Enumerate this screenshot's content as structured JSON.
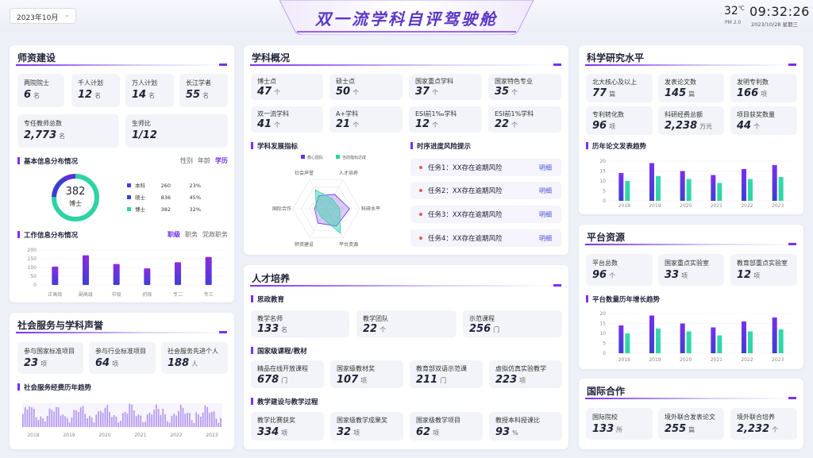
{
  "header": {
    "date_select": "2023年10月",
    "title": "双一流学科自评驾驶舱",
    "temperature": "32",
    "temp_unit": "℃",
    "pm": "PM 2.0",
    "time": "09:32:26",
    "date": "2023/10/28 星期三"
  },
  "colors": {
    "accent": "#7b2ff0",
    "purple": "#5b2fd8",
    "green": "#2ed3a3",
    "indigo": "#3a3fd0"
  },
  "faculty": {
    "title": "师资建设",
    "cards": [
      {
        "label": "两院院士",
        "value": "6",
        "unit": "名"
      },
      {
        "label": "千人计划",
        "value": "12",
        "unit": "名"
      },
      {
        "label": "万人计划",
        "value": "14",
        "unit": "名"
      },
      {
        "label": "长江学者",
        "value": "55",
        "unit": "名"
      },
      {
        "label": "专任教师总数",
        "value": "2,773",
        "unit": "名"
      },
      {
        "label": "生师比",
        "value": "1/12",
        "unit": ""
      }
    ],
    "basic": {
      "title": "基本信息分布情况",
      "tabs": [
        "性别",
        "年龄",
        "学历"
      ],
      "donut_value": "382",
      "donut_label": "博士",
      "legend": [
        {
          "name": "本科",
          "count": "260",
          "pct": "23%",
          "color": "#5b2fd8"
        },
        {
          "name": "硕士",
          "count": "836",
          "pct": "45%",
          "color": "#3a3fd0"
        },
        {
          "name": "博士",
          "count": "382",
          "pct": "32%",
          "color": "#2ed3a3"
        }
      ]
    },
    "work": {
      "title": "工作信息分布情况",
      "tabs": [
        "职级",
        "职务",
        "党政职务"
      ]
    }
  },
  "chart_data": [
    {
      "type": "bar",
      "categories": [
        "正高级",
        "副高级",
        "中级",
        "初级",
        "专二",
        "专三"
      ],
      "values": [
        105,
        170,
        120,
        95,
        130,
        160
      ],
      "ylim": [
        0,
        200
      ],
      "yticks": [
        "200",
        "150",
        "100",
        "50",
        "0"
      ]
    },
    {
      "type": "bar",
      "categories": [
        "2018",
        "2019",
        "2020",
        "2021",
        "2022",
        "2023"
      ],
      "series": [
        {
          "values": [
            14,
            19,
            15,
            13,
            16,
            18
          ]
        },
        {
          "values": [
            10,
            12.5,
            11,
            9,
            11,
            12
          ]
        }
      ],
      "ylim": [
        0,
        20
      ],
      "yticks": [
        "20",
        "15",
        "10",
        "5",
        "0"
      ]
    },
    {
      "type": "bar",
      "categories": [
        "2018",
        "2019",
        "2020",
        "2021",
        "2022",
        "2023"
      ],
      "series": [
        {
          "values": [
            14,
            19,
            15,
            13,
            16,
            18
          ]
        },
        {
          "values": [
            10,
            12.5,
            11,
            9,
            11,
            12
          ]
        }
      ],
      "ylim": [
        0,
        20
      ],
      "yticks": [
        "20",
        "15",
        "10",
        "5",
        "0"
      ]
    },
    {
      "type": "area",
      "x": [
        "2018",
        "2019",
        "2020",
        "2021",
        "2022",
        "2023"
      ]
    },
    {
      "type": "radar",
      "axes": [
        "人才培养",
        "科研水平",
        "平台资源",
        "师资建设",
        "国际合作",
        "社会声誉"
      ],
      "series": [
        {
          "name": "核心团队",
          "values": [
            0.5,
            0.7,
            0.6,
            0.5,
            0.35,
            0.45
          ]
        },
        {
          "name": "当前指标达成",
          "values": [
            0.35,
            0.4,
            0.85,
            0.3,
            0.3,
            0.65
          ]
        }
      ]
    }
  ],
  "social": {
    "title": "社会服务与学科声誉",
    "cards": [
      {
        "label": "参与国家标准项目",
        "value": "23",
        "unit": "项"
      },
      {
        "label": "参与行业标准项目",
        "value": "64",
        "unit": "项"
      },
      {
        "label": "社会服务先进个人",
        "value": "188",
        "unit": "人"
      }
    ],
    "trend_title": "社会服务经费历年趋势"
  },
  "discipline": {
    "title": "学科概况",
    "cards": [
      {
        "label": "博士点",
        "value": "47",
        "unit": "个"
      },
      {
        "label": "硕士点",
        "value": "50",
        "unit": "个"
      },
      {
        "label": "国家重点学科",
        "value": "37",
        "unit": "个"
      },
      {
        "label": "国家特色专业",
        "value": "35",
        "unit": "个"
      },
      {
        "label": "双一流学科",
        "value": "41",
        "unit": "个"
      },
      {
        "label": "A+学科",
        "value": "21",
        "unit": "个"
      },
      {
        "label": "ESI前1‰学科",
        "value": "12",
        "unit": "个"
      },
      {
        "label": "ESI前1%学科",
        "value": "22",
        "unit": "个"
      }
    ],
    "indicator_title": "学科发展指标",
    "risk_title": "时序进度风险提示",
    "risks": [
      {
        "text": "任务1：XX存在逾期风险",
        "link": "明细"
      },
      {
        "text": "任务2：XX存在逾期风险",
        "link": "明细"
      },
      {
        "text": "任务3：XX存在逾期风险",
        "link": "明细"
      },
      {
        "text": "任务4：XX存在逾期风险",
        "link": "明细"
      }
    ]
  },
  "talent": {
    "title": "人才培养",
    "sections": [
      {
        "title": "思政教育",
        "cards": [
          {
            "label": "教学名师",
            "value": "133",
            "unit": "名"
          },
          {
            "label": "教学团队",
            "value": "22",
            "unit": "个"
          },
          {
            "label": "示范课程",
            "value": "256",
            "unit": "门"
          }
        ]
      },
      {
        "title": "国家级课程/教材",
        "cards": [
          {
            "label": "精品在线开放课程",
            "value": "678",
            "unit": "门"
          },
          {
            "label": "国家级教材奖",
            "value": "107",
            "unit": "项"
          },
          {
            "label": "教育部双语示范课",
            "value": "211",
            "unit": "门"
          },
          {
            "label": "虚拟仿真实验教学",
            "value": "223",
            "unit": "项"
          }
        ]
      },
      {
        "title": "教学建设与教学过程",
        "cards": [
          {
            "label": "教学比赛获奖",
            "value": "334",
            "unit": "项"
          },
          {
            "label": "国家级教学成果奖",
            "value": "32",
            "unit": "项"
          },
          {
            "label": "国家级教学项目",
            "value": "62",
            "unit": "项"
          },
          {
            "label": "教授本科授课比",
            "value": "93",
            "unit": "%"
          }
        ]
      }
    ]
  },
  "research": {
    "title": "科学研究水平",
    "cards": [
      {
        "label": "北大核心及以上",
        "value": "77",
        "unit": "篇"
      },
      {
        "label": "发表论文数",
        "value": "145",
        "unit": "篇"
      },
      {
        "label": "发明专利数",
        "value": "166",
        "unit": "项"
      },
      {
        "label": "专利转化数",
        "value": "96",
        "unit": "项"
      },
      {
        "label": "科研经费总额",
        "value": "2,238",
        "unit": "万元"
      },
      {
        "label": "项目获奖数量",
        "value": "44",
        "unit": "个"
      }
    ],
    "trend_title": "历年论文发表趋势"
  },
  "platform": {
    "title": "平台资源",
    "cards": [
      {
        "label": "平台总数",
        "value": "96",
        "unit": "个"
      },
      {
        "label": "国家重点实验室",
        "value": "33",
        "unit": "项"
      },
      {
        "label": "教育部重点实验室",
        "value": "12",
        "unit": "项"
      }
    ],
    "trend_title": "平台数量历年增长趋势"
  },
  "international": {
    "title": "国际合作",
    "cards": [
      {
        "label": "国际院校",
        "value": "133",
        "unit": "所"
      },
      {
        "label": "境外联合发表论文",
        "value": "255",
        "unit": "篇"
      },
      {
        "label": "境外联合培养",
        "value": "2,232",
        "unit": "个"
      }
    ]
  }
}
